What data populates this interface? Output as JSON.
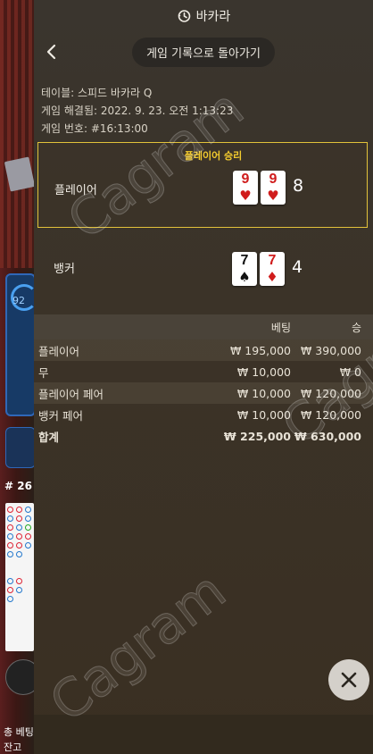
{
  "panel": {
    "title": "바카라",
    "back_label": "게임 기록으로 돌아가기"
  },
  "info": {
    "table": "테이블: 스피드 바카라 Q",
    "resolved": "게임 해결됨: 2022. 9. 23. 오전 1:13:23",
    "game_no": "게임 번호: #16:13:00"
  },
  "result": {
    "winner_label": "플레이어 승리",
    "player": {
      "label": "플레이어",
      "score": "8",
      "cards": [
        {
          "rank": "9",
          "suit": "♥",
          "color": "red"
        },
        {
          "rank": "9",
          "suit": "♥",
          "color": "red"
        }
      ]
    },
    "banker": {
      "label": "뱅커",
      "score": "4",
      "cards": [
        {
          "rank": "7",
          "suit": "♠",
          "color": "black"
        },
        {
          "rank": "7",
          "suit": "♦",
          "color": "red"
        }
      ]
    }
  },
  "bets": {
    "headers": {
      "bet": "베팅",
      "win": "승"
    },
    "rows": [
      {
        "name": "플레이어",
        "bet": "₩ 195,000",
        "win": "₩ 390,000"
      },
      {
        "name": "무",
        "bet": "₩ 10,000",
        "win": "₩ 0"
      },
      {
        "name": "플레이어 페어",
        "bet": "₩ 10,000",
        "win": "₩ 120,000"
      },
      {
        "name": "뱅커 페어",
        "bet": "₩ 10,000",
        "win": "₩ 120,000"
      }
    ],
    "total": {
      "name": "합계",
      "bet": "₩ 225,000",
      "win": "₩ 630,000"
    }
  },
  "background": {
    "timer": "92",
    "round": "# 26",
    "total_bet": "총 베팅",
    "balance": "잔고"
  },
  "watermark": "Cagram",
  "colors": {
    "accent": "#e2c23a",
    "winner_text": "#f4cc2e"
  },
  "icons": {
    "history": "history-icon",
    "back": "chevron-left-icon",
    "close": "close-icon"
  }
}
